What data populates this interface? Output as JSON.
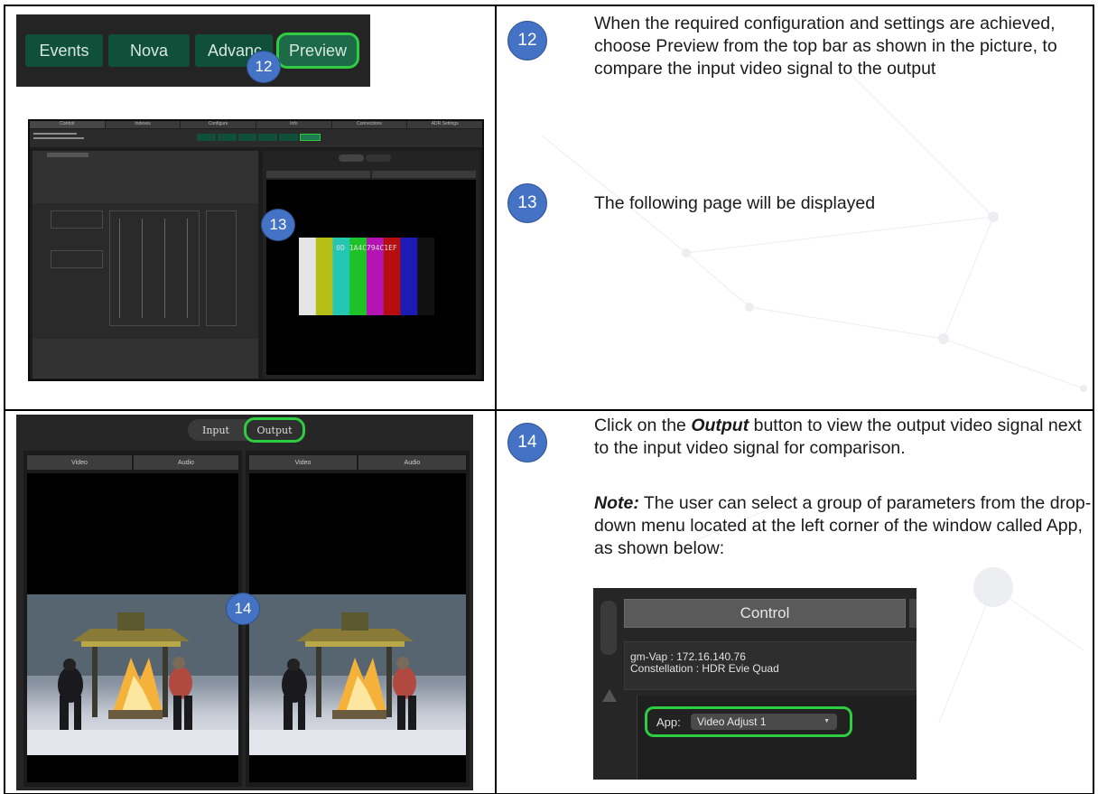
{
  "steps": {
    "s12": {
      "badge": "12",
      "text": "When the required configuration and settings are achieved, choose Preview from the top bar as shown in the picture, to compare the input video signal to the output",
      "topbar": {
        "buttons": [
          "Events",
          "Nova",
          "Advanc",
          "Preview"
        ],
        "badge": "12"
      }
    },
    "s13": {
      "badge": "13",
      "text": "The following page will be displayed",
      "shot": {
        "badge": "13",
        "tabs": [
          "Control",
          "Indexes",
          "Configure",
          "Info",
          "Connections",
          "ADR Settings"
        ],
        "bars_text": "0D 1A4C794C1EF",
        "bar_colors": [
          "#e4e4e4",
          "#b5bd17",
          "#24c6b4",
          "#1dc227",
          "#b414b4",
          "#b50d10",
          "#1c1cb4",
          "#111111"
        ]
      }
    },
    "s14": {
      "badge": "14",
      "click_prefix": "Click on the ",
      "click_word": "Output",
      "click_suffix": " button to view the output video signal next to the input video signal for comparison.",
      "note_label": "Note:",
      "note_text": " The user can select a group of parameters from the drop-down menu located at the left corner of the window called App, as shown below:",
      "preview": {
        "badge": "14",
        "input_label": "Input",
        "output_label": "Output",
        "left_tabs": [
          "Video",
          "Audio"
        ],
        "right_tabs": [
          "Video",
          "Audio"
        ]
      },
      "control": {
        "title": "Control",
        "device_line": "gm-Vap : 172.16.140.76",
        "constellation_line": "Constellation : HDR Evie Quad",
        "app_label": "App:",
        "app_value": "Video Adjust 1"
      }
    }
  },
  "colors": {
    "badge": "#4472c4",
    "highlight": "#2ecc40",
    "button": "#10503a"
  }
}
